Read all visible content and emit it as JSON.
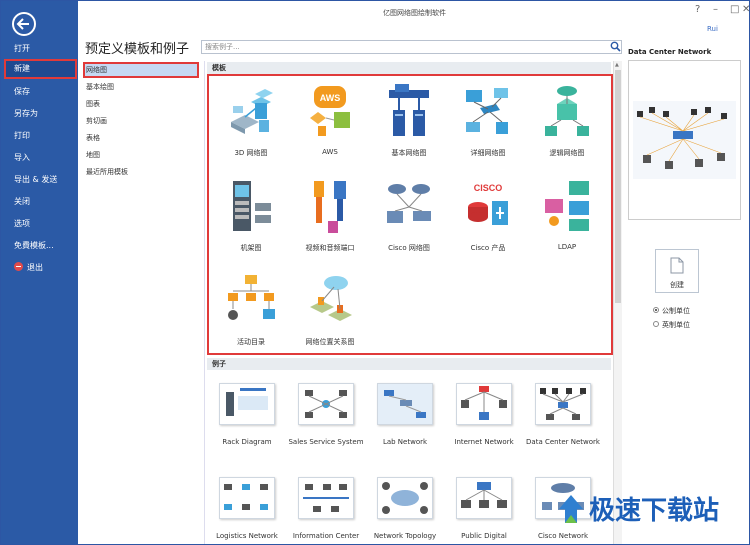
{
  "window": {
    "title": "亿图网络图绘制软件",
    "user": "Rui"
  },
  "sidebar": {
    "items": [
      {
        "label": "打开"
      },
      {
        "label": "新建"
      },
      {
        "label": "保存"
      },
      {
        "label": "另存为"
      },
      {
        "label": "打印"
      },
      {
        "label": "导入"
      },
      {
        "label": "导出 & 发送"
      },
      {
        "label": "关闭"
      },
      {
        "label": "选项"
      },
      {
        "label": "免費模板..."
      },
      {
        "label": "退出"
      }
    ]
  },
  "page": {
    "title": "预定义模板和例子"
  },
  "search": {
    "placeholder": "搜索例子..."
  },
  "categories": [
    {
      "label": "网络图"
    },
    {
      "label": "基本绘图"
    },
    {
      "label": "图表"
    },
    {
      "label": "剪切画"
    },
    {
      "label": "表格"
    },
    {
      "label": "地图"
    },
    {
      "label": "最近所用模板"
    }
  ],
  "templates_header": "模板",
  "templates": [
    {
      "label": "3D 网络图",
      "icon": "3d-network-icon"
    },
    {
      "label": "AWS",
      "icon": "aws-icon"
    },
    {
      "label": "基本网络图",
      "icon": "basic-network-icon"
    },
    {
      "label": "详细网络图",
      "icon": "detailed-network-icon"
    },
    {
      "label": "逻辑网络图",
      "icon": "logical-network-icon"
    },
    {
      "label": "机架图",
      "icon": "rack-icon"
    },
    {
      "label": "视频和音频端口",
      "icon": "av-ports-icon"
    },
    {
      "label": "Cisco 网络图",
      "icon": "cisco-network-icon"
    },
    {
      "label": "Cisco 产品",
      "icon": "cisco-products-icon"
    },
    {
      "label": "LDAP",
      "icon": "ldap-icon"
    },
    {
      "label": "活动目录",
      "icon": "active-directory-icon"
    },
    {
      "label": "网络位置关系图",
      "icon": "network-location-icon"
    }
  ],
  "aws_badge": "AWS",
  "cisco_badge": "CISCO",
  "examples_header": "例子",
  "examples": [
    {
      "label": "Rack Diagram"
    },
    {
      "label": "Sales Service System"
    },
    {
      "label": "Lab Network"
    },
    {
      "label": "Internet Network"
    },
    {
      "label": "Data Center Network"
    },
    {
      "label": "Logistics Network"
    },
    {
      "label": "Information Center"
    },
    {
      "label": "Network Topology"
    },
    {
      "label": "Public Digital"
    },
    {
      "label": "Cisco Network"
    }
  ],
  "preview": {
    "title": "Data Center Network"
  },
  "create": {
    "label": "创建"
  },
  "units": [
    {
      "label": "公制单位",
      "selected": true
    },
    {
      "label": "英制单位",
      "selected": false
    }
  ],
  "watermark": "极速下载站",
  "colors": {
    "sidebar": "#2b5aa6",
    "highlight": "#e03a3a",
    "accent": "#3a9fd8"
  }
}
